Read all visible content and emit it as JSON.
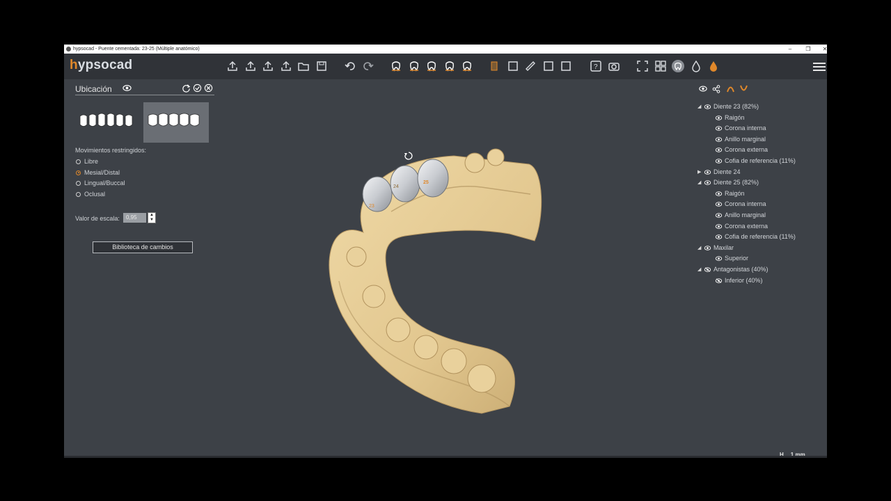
{
  "window": {
    "title": "hypsocad - Puente cementada: 23-25 (Múltiple anatómico)"
  },
  "app": {
    "logo_h": "h",
    "logo_rest": "ypsocad"
  },
  "toolbar": {
    "groups": [
      [
        "import-icon",
        "export-icon",
        "export-alt-icon",
        "share-export-icon",
        "open-folder-icon",
        "save-icon"
      ],
      [
        "undo-icon",
        "redo-icon"
      ],
      [
        "tooth-view-1-icon",
        "tooth-view-2-icon",
        "tooth-view-3-icon",
        "tooth-view-4-icon",
        "tooth-view-5-icon"
      ],
      [
        "model-icon",
        "tooth-edit-icon",
        "ruler-icon",
        "section-icon",
        "crop-icon"
      ],
      [
        "help-icon",
        "camera-icon"
      ],
      [
        "fullscreen-icon",
        "grid-icon",
        "tooth-active-icon",
        "drop-icon",
        "drop-orange-icon"
      ]
    ],
    "accent": "#e0882a"
  },
  "panel": {
    "title": "Ubicación",
    "restricted_label": "Movimientos restringidos:",
    "options": [
      "Libre",
      "Mesial/Distal",
      "Lingual/Buccal",
      "Oclusal"
    ],
    "selected_option": "Mesial/Distal",
    "scale_label": "Valor de escala:",
    "scale_value": "0,95",
    "library_button": "Biblioteca de cambios"
  },
  "tree": {
    "items": [
      {
        "label": "Diente 23 (82%)",
        "level": 0,
        "expanded": true
      },
      {
        "label": "Raigón",
        "level": 1
      },
      {
        "label": "Corona interna",
        "level": 1
      },
      {
        "label": "Anillo marginal",
        "level": 1
      },
      {
        "label": "Corona externa",
        "level": 1
      },
      {
        "label": "Cofia de referencia  (11%)",
        "level": 1
      },
      {
        "label": "Diente 24",
        "level": 0,
        "expanded": false
      },
      {
        "label": "Diente 25 (82%)",
        "level": 0,
        "expanded": true
      },
      {
        "label": "Raigón",
        "level": 1
      },
      {
        "label": "Corona interna",
        "level": 1
      },
      {
        "label": "Anillo marginal",
        "level": 1
      },
      {
        "label": "Corona externa",
        "level": 1
      },
      {
        "label": "Cofia de referencia  (11%)",
        "level": 1
      },
      {
        "label": "Maxilar",
        "level": 0,
        "expanded": true
      },
      {
        "label": "Superior",
        "level": 1
      },
      {
        "label": "Antagonistas (40%)",
        "level": 0,
        "expanded": true,
        "hidden": true
      },
      {
        "label": "Inferior (40%)",
        "level": 1,
        "hidden": true
      }
    ]
  },
  "viewport": {
    "tooth_labels": [
      "23",
      "24",
      "25"
    ],
    "scale_h": "H",
    "scale_value": "1 mm"
  }
}
